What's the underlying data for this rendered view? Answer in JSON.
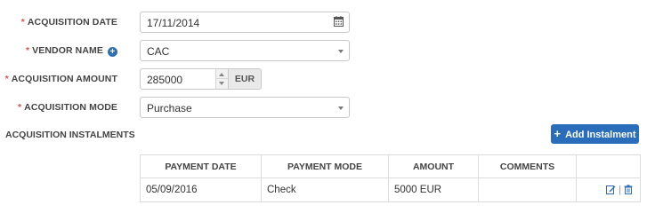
{
  "form": {
    "acquisition_date": {
      "required_mark": "*",
      "label": "ACQUISITION DATE",
      "value": "17/11/2014"
    },
    "vendor_name": {
      "required_mark": "*",
      "label": "VENDOR NAME",
      "value": "CAC",
      "info_glyph": "+"
    },
    "acquisition_amount": {
      "required_mark": "*",
      "label": "ACQUISITION AMOUNT",
      "value": "285000",
      "currency": "EUR"
    },
    "acquisition_mode": {
      "required_mark": "*",
      "label": "ACQUISITION MODE",
      "value": "Purchase"
    }
  },
  "instalments": {
    "title": "ACQUISITION INSTALMENTS",
    "add_button_icon": "+",
    "add_button_label": "Add Instalment",
    "columns": [
      "PAYMENT DATE",
      "PAYMENT MODE",
      "AMOUNT",
      "COMMENTS",
      ""
    ],
    "rows": [
      {
        "payment_date": "05/09/2016",
        "payment_mode": "Check",
        "amount": "5000 EUR",
        "comments": "",
        "separator": "|"
      }
    ]
  },
  "colors": {
    "required": "#d9534f",
    "primary": "#2a6ebb",
    "icon_blue": "#2f6fb5"
  },
  "icons": [
    "calendar-icon",
    "info-plus-icon",
    "dropdown-caret-icon",
    "spinner-up-icon",
    "spinner-down-icon",
    "plus-icon",
    "edit-icon",
    "trash-icon"
  ]
}
